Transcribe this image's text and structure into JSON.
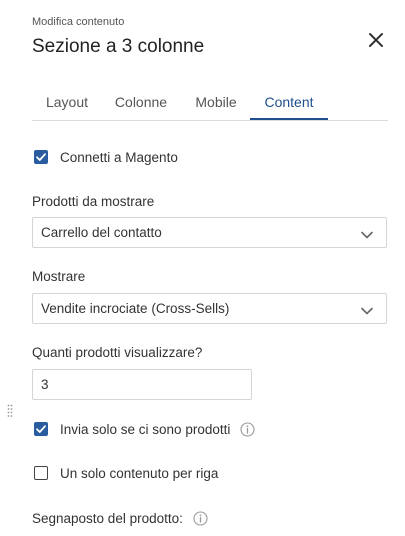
{
  "header": {
    "subtitle": "Modifica contenuto",
    "title": "Sezione a 3 colonne"
  },
  "tabs": [
    {
      "label": "Layout",
      "active": false
    },
    {
      "label": "Colonne",
      "active": false
    },
    {
      "label": "Mobile",
      "active": false
    },
    {
      "label": "Content",
      "active": true
    }
  ],
  "form": {
    "connect": {
      "label": "Connetti a Magento",
      "checked": true
    },
    "products_to_show": {
      "label": "Prodotti da mostrare",
      "value": "Carrello del contatto"
    },
    "show": {
      "label": "Mostrare",
      "value": "Vendite incrociate (Cross-Sells)"
    },
    "product_count": {
      "label": "Quanti prodotti visualizzare?",
      "value": "3"
    },
    "send_only_if_products": {
      "label": "Invia solo se ci sono prodotti",
      "checked": true
    },
    "one_per_row": {
      "label": "Un solo contenuto per riga",
      "checked": false
    },
    "placeholder_label": "Segnaposto del prodotto:"
  },
  "colors": {
    "accent": "#1f4f8f",
    "checkbox": "#2a5d9f"
  }
}
